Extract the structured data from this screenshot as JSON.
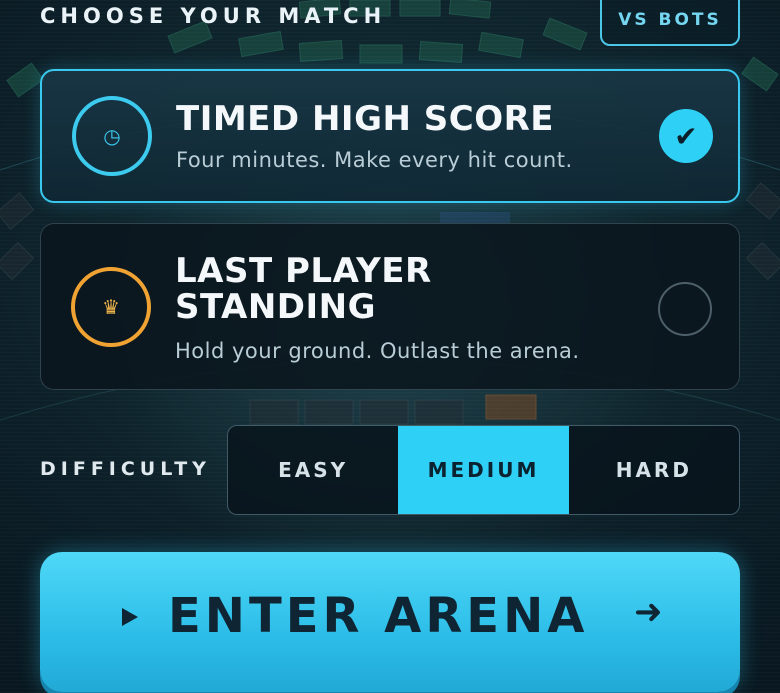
{
  "header": {
    "title": "CHOOSE YOUR MATCH",
    "bots_button": "VS BOTS"
  },
  "modes": [
    {
      "title": "TIMED HIGH SCORE",
      "description": "Four minutes. Make every hit count.",
      "icon": "timer-icon",
      "icon_glyph": "◷",
      "selected": true,
      "check_glyph": "✔"
    },
    {
      "title": "LAST PLAYER STANDING",
      "description": "Hold your ground. Outlast the arena.",
      "icon": "crown-icon",
      "icon_glyph": "♛",
      "selected": false
    }
  ],
  "difficulty": {
    "label": "DIFFICULTY",
    "options": [
      "EASY",
      "MEDIUM",
      "HARD"
    ],
    "selected": "MEDIUM"
  },
  "enter_button": {
    "label": "ENTER ARENA",
    "play_icon": "play-icon",
    "arrow_icon": "arrow-right-icon",
    "arrow_glyph": "➜"
  },
  "colors": {
    "accent": "#2fd0f5",
    "gold": "#f0a332",
    "background": "#0a1a24"
  }
}
